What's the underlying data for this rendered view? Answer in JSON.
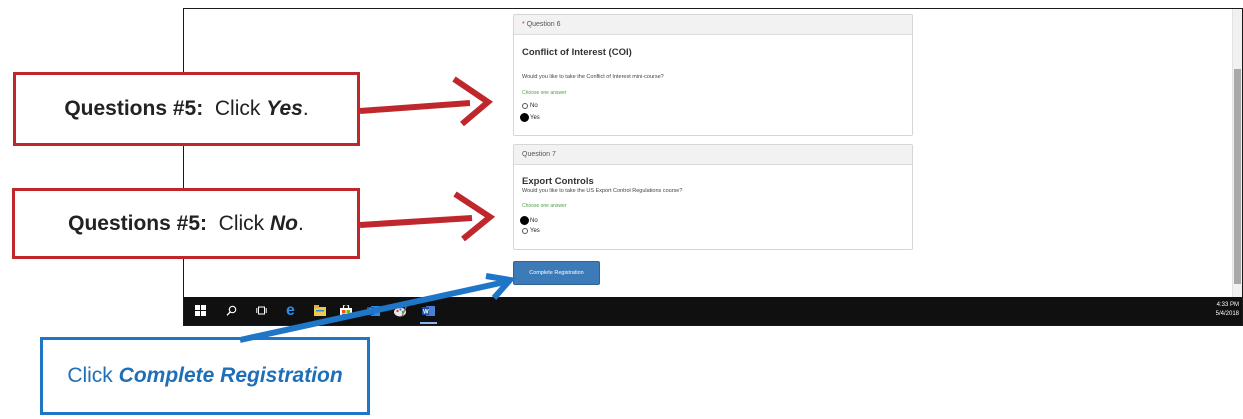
{
  "question6": {
    "header_required_marker": "*",
    "header_label": "Question 6",
    "title": "Conflict of Interest (COI)",
    "prompt": "Would you like to take the Conflict of Interest mini-course?",
    "hint": "Choose one answer",
    "options": [
      {
        "label": "No",
        "selected": false
      },
      {
        "label": "Yes",
        "selected": true
      }
    ]
  },
  "question7": {
    "header_label": "Question 7",
    "title": "Export Controls",
    "prompt": "Would you like to take the US Export Control Regulations course?",
    "hint": "Choose one answer",
    "options": [
      {
        "label": "No",
        "selected": true
      },
      {
        "label": "Yes",
        "selected": false
      }
    ]
  },
  "complete_button": {
    "label": "Complete Registration"
  },
  "taskbar": {
    "time": "4:33 PM",
    "date": "5/4/2018"
  },
  "callouts": {
    "yes": {
      "prefix": "Questions #5:",
      "mid": "Click",
      "emph": "Yes",
      "suffix": "."
    },
    "no": {
      "prefix": "Questions #5:",
      "mid": "Click",
      "emph": "No",
      "suffix": "."
    },
    "complete": {
      "mid": "Click",
      "emph": "Complete Registration"
    }
  },
  "colors": {
    "callout_red": "#c0272d",
    "callout_blue": "#1f75c6",
    "button_blue": "#3d7ab8",
    "hint_green": "#4ea048"
  }
}
